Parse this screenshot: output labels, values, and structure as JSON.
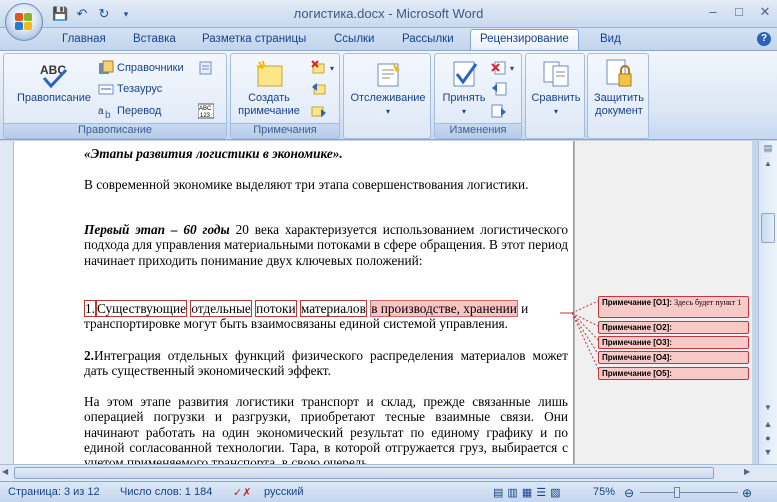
{
  "window": {
    "title": "логистика.docx - Microsoft Word"
  },
  "qat": {
    "save_icon": "save-icon",
    "undo_icon": "undo-icon",
    "redo_icon": "redo-icon"
  },
  "tabs": [
    {
      "label": "Главная"
    },
    {
      "label": "Вставка"
    },
    {
      "label": "Разметка страницы"
    },
    {
      "label": "Ссылки"
    },
    {
      "label": "Рассылки"
    },
    {
      "label": "Рецензирование"
    },
    {
      "label": "Вид"
    }
  ],
  "ribbon": {
    "proofing": {
      "label": "Правописание",
      "spelling": "Правописание",
      "research": "Справочники",
      "thesaurus": "Тезаурус",
      "translate": "Перевод"
    },
    "comments": {
      "label": "Примечания",
      "new_comment_1": "Создать",
      "new_comment_2": "примечание"
    },
    "tracking": {
      "label": "Отслеживание"
    },
    "changes": {
      "label": "Изменения",
      "accept": "Принять"
    },
    "compare": {
      "label": "Сравнить"
    },
    "protect": {
      "label_1": "Защитить",
      "label_2": "документ"
    }
  },
  "document": {
    "heading": "«Этапы развития логистики в экономике».",
    "p1": "В современной экономике выделяют три этапа совершенствования логистики.",
    "p2_bold": "Первый этап – 60 годы",
    "p2_rest": " 20 века характеризуется использованием логистического подхода для управления материальными потоками в сфере обращения. В этот период начинает приходить понимание двух ключевых положений:",
    "p3_num": "1.",
    "p3_words": [
      "Существующие",
      " ",
      "отдельные",
      " ",
      "потоки",
      " ",
      "материалов",
      " ",
      "в производстве, хранении",
      " ",
      "и"
    ],
    "p3_rest": "транспортировке могут быть взаимосвязаны единой системой управления.",
    "p4_num": "2.",
    "p4_rest": "Интеграция отдельных функций физического распределения материалов может дать существенный экономический эффект.",
    "p5": "На этом этапе развития логистики транспорт и склад, прежде связанные лишь операцией погрузки и разгрузки, приобретают тесные взаимные связи. Они начинают работать на один экономический результат по единому графику и по единой согласованной технологии. Тара, в которой отгружается груз, выбирается с учетом применяемого транспорта, в свою очередь"
  },
  "comments": [
    {
      "label": "Примечание [O1]:",
      "text": "Здесь будет пункт 1"
    },
    {
      "label": "Примечание [O2]:",
      "text": ""
    },
    {
      "label": "Примечание [O3]:",
      "text": ""
    },
    {
      "label": "Примечание [O4]:",
      "text": ""
    },
    {
      "label": "Примечание [O5]:",
      "text": ""
    }
  ],
  "status": {
    "page": "Страница: 3 из 12",
    "words": "Число слов: 1 184",
    "language": "русский",
    "zoom": "75%"
  },
  "colors": {
    "comment_fill": "#f7c9c9",
    "comment_border": "#c23838",
    "ribbon_text": "#15428b"
  }
}
